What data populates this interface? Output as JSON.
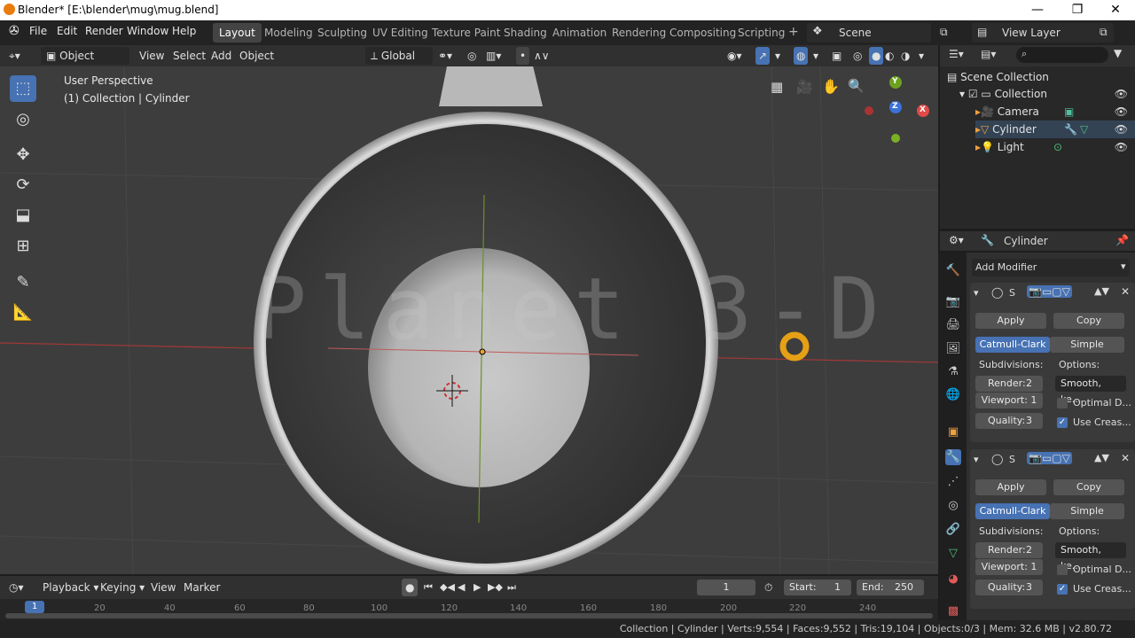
{
  "window": {
    "title": "Blender* [E:\\blender\\mug\\mug.blend]",
    "controls": [
      "—",
      "❐",
      "✕"
    ]
  },
  "menu": [
    "File",
    "Edit",
    "Render",
    "Window",
    "Help"
  ],
  "workspaces": [
    {
      "label": "Layout",
      "active": true
    },
    {
      "label": "Modeling"
    },
    {
      "label": "Sculpting"
    },
    {
      "label": "UV Editing"
    },
    {
      "label": "Texture Paint"
    },
    {
      "label": "Shading"
    },
    {
      "label": "Animation"
    },
    {
      "label": "Rendering"
    },
    {
      "label": "Compositing"
    },
    {
      "label": "Scripting"
    }
  ],
  "add_workspace": "+",
  "scene": {
    "label": "Scene"
  },
  "view_layer": {
    "label": "View Layer"
  },
  "viewport_header": {
    "mode": "Object Mode",
    "menus": [
      "View",
      "Select",
      "Add",
      "Object"
    ],
    "transform": "Global"
  },
  "viewport": {
    "overlay_title": "User Perspective",
    "overlay_sub": "(1) Collection | Cylinder",
    "watermark": "Planet 3-D",
    "gizmo": {
      "y": "Y",
      "z": "Z",
      "x": "X"
    }
  },
  "outliner": {
    "items": [
      {
        "label": "Scene Collection"
      },
      {
        "label": "Collection"
      },
      {
        "label": "Camera"
      },
      {
        "label": "Cylinder"
      },
      {
        "label": "Light"
      }
    ]
  },
  "properties": {
    "object_name": "Cylinder",
    "add_modifier": "Add Modifier",
    "modifiers": [
      {
        "apply": "Apply",
        "copy": "Copy",
        "catmull": "Catmull-Clark",
        "simple": "Simple",
        "subdivisions": "Subdivisions:",
        "options": "Options:",
        "render": "Render:",
        "render_val": "2",
        "viewport": "Viewport: 1",
        "quality": "Quality:",
        "quality_val": "3",
        "smooth": "Smooth, ke...",
        "optimal": "Optimal D...",
        "creases": "Use Creas..."
      },
      {
        "apply": "Apply",
        "copy": "Copy",
        "catmull": "Catmull-Clark",
        "simple": "Simple",
        "subdivisions": "Subdivisions:",
        "options": "Options:",
        "render": "Render:",
        "render_val": "2",
        "viewport": "Viewport: 1",
        "quality": "Quality:",
        "quality_val": "3",
        "smooth": "Smooth, ke...",
        "optimal": "Optimal D...",
        "creases": "Use Creas..."
      }
    ]
  },
  "timeline": {
    "menus": [
      "Playback",
      "Keying",
      "View",
      "Marker"
    ],
    "current_frame": "1",
    "start_label": "Start:",
    "start": "1",
    "end_label": "End:",
    "end": "250",
    "ticks": [
      "1",
      "20",
      "40",
      "60",
      "80",
      "100",
      "120",
      "140",
      "160",
      "180",
      "200",
      "220",
      "240"
    ]
  },
  "status": "Collection | Cylinder | Verts:9,554 | Faces:9,552 | Tris:19,104 | Objects:0/3 | Mem: 32.6 MB | v2.80.72"
}
